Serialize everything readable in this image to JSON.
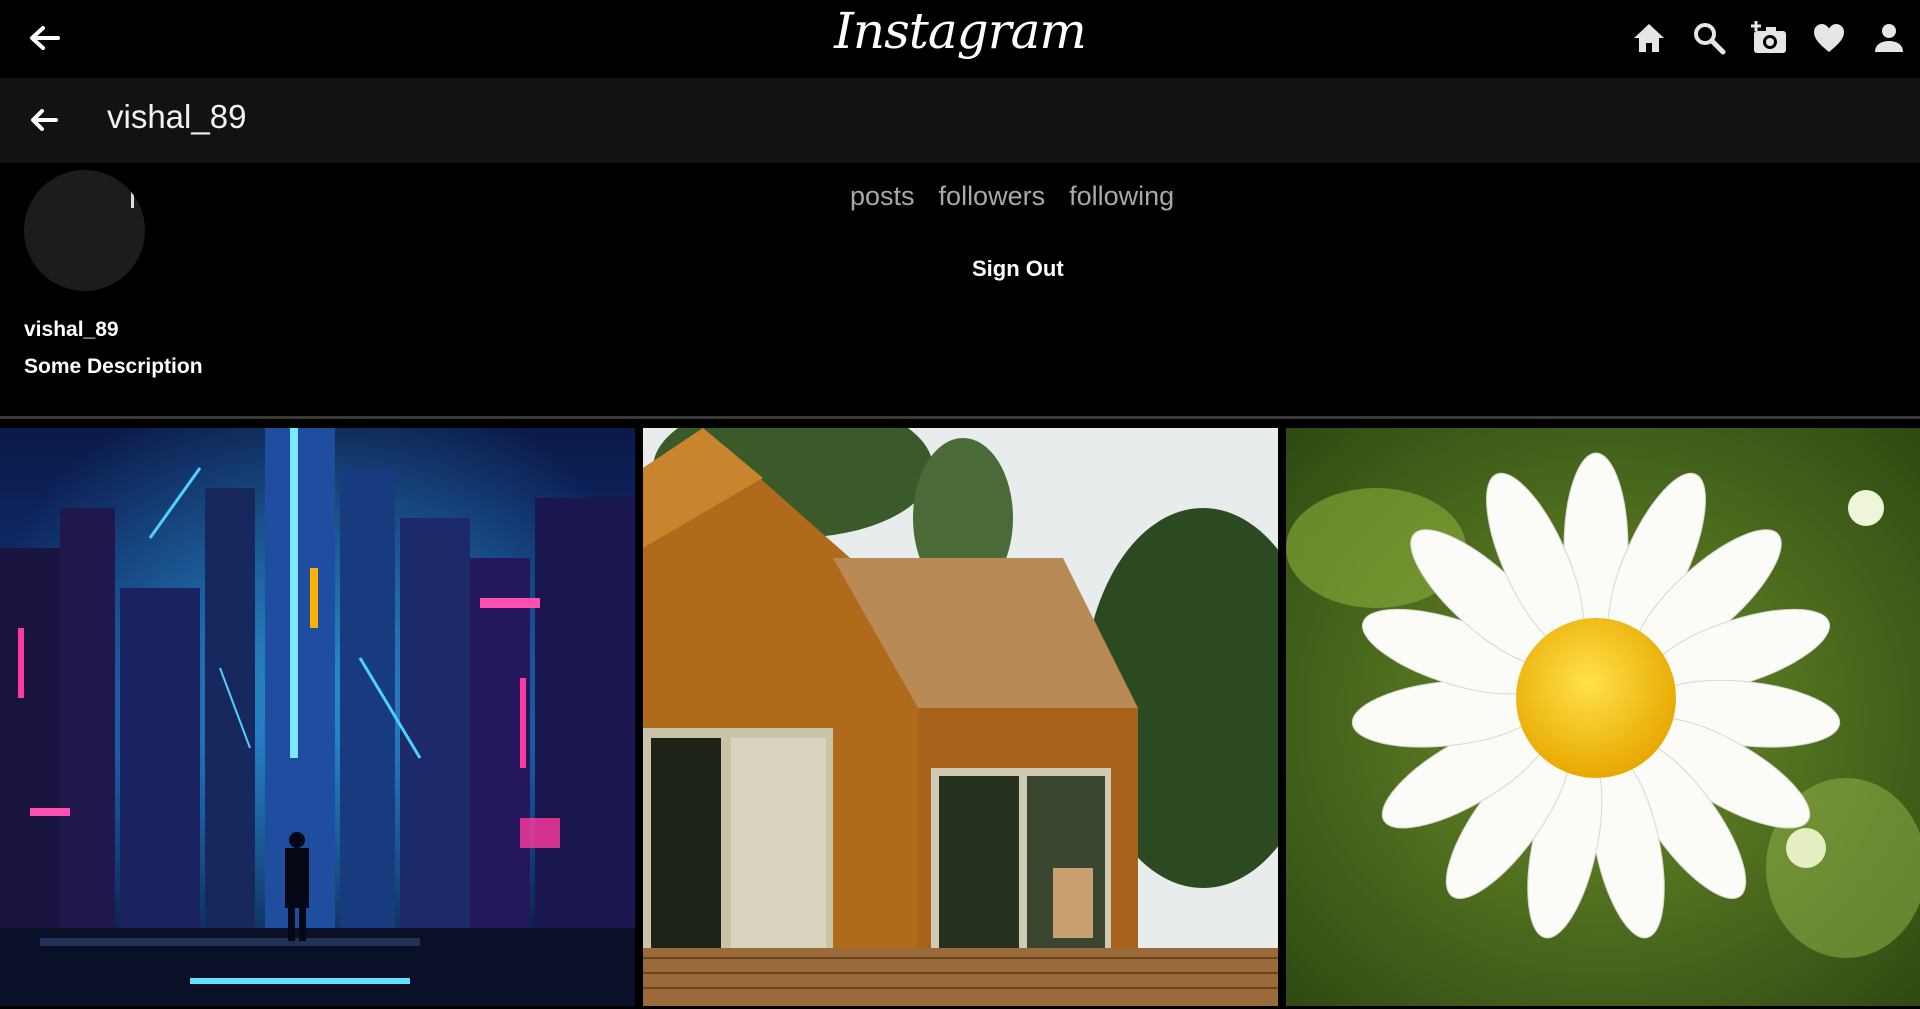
{
  "app": {
    "logo_text": "Instagram"
  },
  "topbar": {
    "icons": [
      "back-arrow-icon",
      "home-icon",
      "search-icon",
      "add-photo-icon",
      "heart-icon",
      "person-icon"
    ]
  },
  "profile_header": {
    "username": "vishal_89"
  },
  "profile": {
    "stats": {
      "posts_label": "posts",
      "followers_label": "followers",
      "following_label": "following"
    },
    "sign_out_label": "Sign Out",
    "name": "vishal_89",
    "description": "Some Description"
  },
  "posts": [
    {
      "subject": "neon cyberpunk city"
    },
    {
      "subject": "wooden house with deck"
    },
    {
      "subject": "white daisy flower"
    }
  ],
  "colors": {
    "background": "#000000",
    "header_bar": "#121212",
    "muted_text": "#a8a8a8"
  }
}
